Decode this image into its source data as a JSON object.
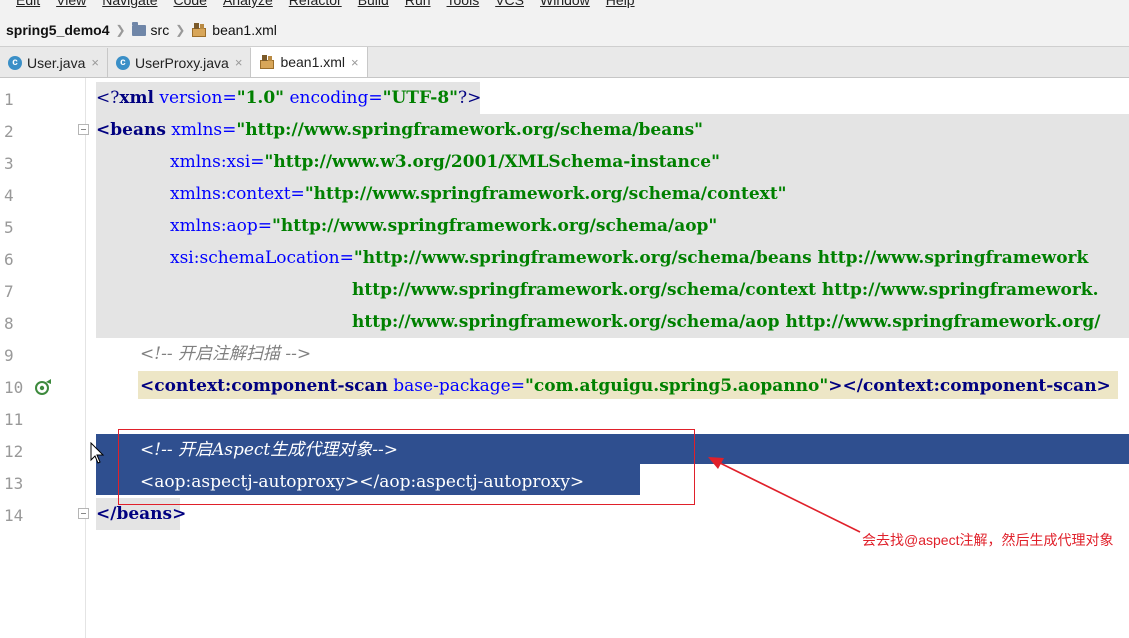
{
  "menubar": {
    "items": [
      "Edit",
      "View",
      "Navigate",
      "Code",
      "Analyze",
      "Refactor",
      "Build",
      "Run",
      "Tools",
      "VCS",
      "Window",
      "Help"
    ]
  },
  "breadcrumb": {
    "project": "spring5_demo4",
    "folder": "src",
    "file": "bean1.xml"
  },
  "tabs": [
    {
      "label": "User.java",
      "icon": "c-class-icon",
      "close": "×"
    },
    {
      "label": "UserProxy.java",
      "icon": "c-class-icon",
      "close": "×"
    },
    {
      "label": "bean1.xml",
      "icon": "xml-file-icon",
      "close": "×",
      "active": true
    }
  ],
  "editor": {
    "line_numbers": [
      "1",
      "2",
      "3",
      "4",
      "5",
      "6",
      "7",
      "8",
      "9",
      "10",
      "11",
      "12",
      "13",
      "14"
    ],
    "lines": {
      "l1": {
        "open": "<?",
        "name": "xml",
        "a1": " version=",
        "v1": "\"1.0\"",
        "a2": " encoding=",
        "v2": "\"UTF-8\"",
        "close": "?>"
      },
      "l2": {
        "open": "<beans",
        "a1": " xmlns=",
        "v1": "\"http://www.springframework.org/schema/beans\""
      },
      "l3": {
        "a1": "xmlns:xsi=",
        "v1": "\"http://www.w3.org/2001/XMLSchema-instance\""
      },
      "l4": {
        "a1": "xmlns:context=",
        "v1": "\"http://www.springframework.org/schema/context\""
      },
      "l5": {
        "a1": "xmlns:aop=",
        "v1": "\"http://www.springframework.org/schema/aop\""
      },
      "l6": {
        "a1": "xsi:schemaLocation=",
        "v1": "\"http://www.springframework.org/schema/beans http://www.springframework"
      },
      "l7": {
        "v1": "http://www.springframework.org/schema/context http://www.springframework."
      },
      "l8": {
        "v1": "http://www.springframework.org/schema/aop http://www.springframework.org/"
      },
      "l9": {
        "comment": "<!-- 开启注解扫描 -->"
      },
      "l10": {
        "open": "<context:component-scan",
        "a1": " base-package=",
        "v1": "\"com.atguigu.spring5.aopanno\"",
        "close": "></context:component-scan>"
      },
      "l12": {
        "comment": "<!-- 开启Aspect生成代理对象-->"
      },
      "l13": {
        "code": "<aop:aspectj-autoproxy></aop:aspectj-autoproxy>"
      },
      "l14": {
        "code": "</beans>"
      }
    }
  },
  "annotation": {
    "text": "会去找@aspect注解，然后生成代理对象",
    "color": "#e0202a"
  },
  "colors": {
    "selection": "#2f4f8f",
    "highlight_band": "#e4e4e4",
    "tag": "#000080",
    "attr": "#0000ff",
    "value": "#008000",
    "comment": "#808080",
    "component_scan_bg": "#ede6c6"
  }
}
